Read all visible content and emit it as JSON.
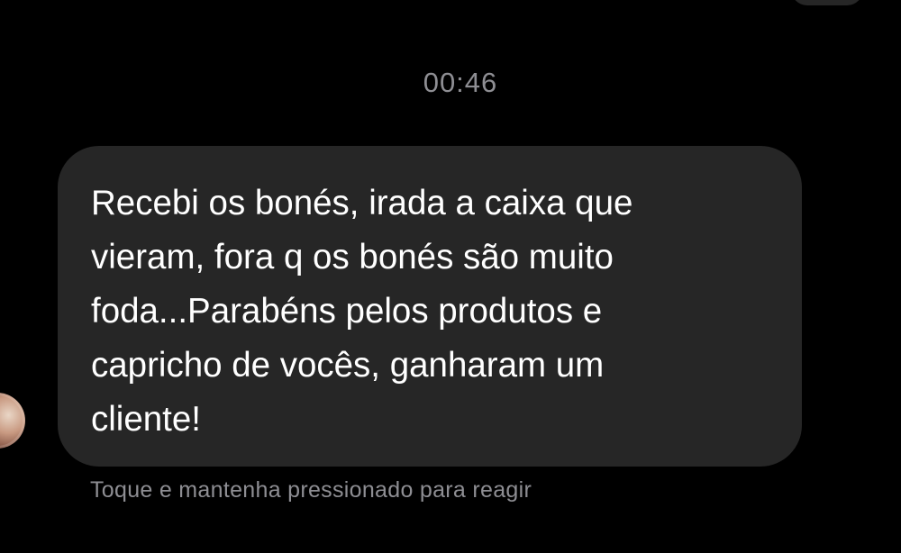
{
  "chat": {
    "timestamp": "00:46",
    "message": {
      "text": "Recebi os bonés, irada a caixa que\nvieram, fora q os bonés são muito\nfoda...Parabéns pelos produtos e\ncapricho de vocês, ganharam um\ncliente!"
    },
    "react_hint": "Toque e mantenha pressionado para reagir",
    "sender_avatar_icon": "user-avatar-icon"
  },
  "colors": {
    "background": "#000000",
    "bubble": "#262626",
    "message_text": "#ffffff",
    "secondary_text": "#8e8e93"
  }
}
